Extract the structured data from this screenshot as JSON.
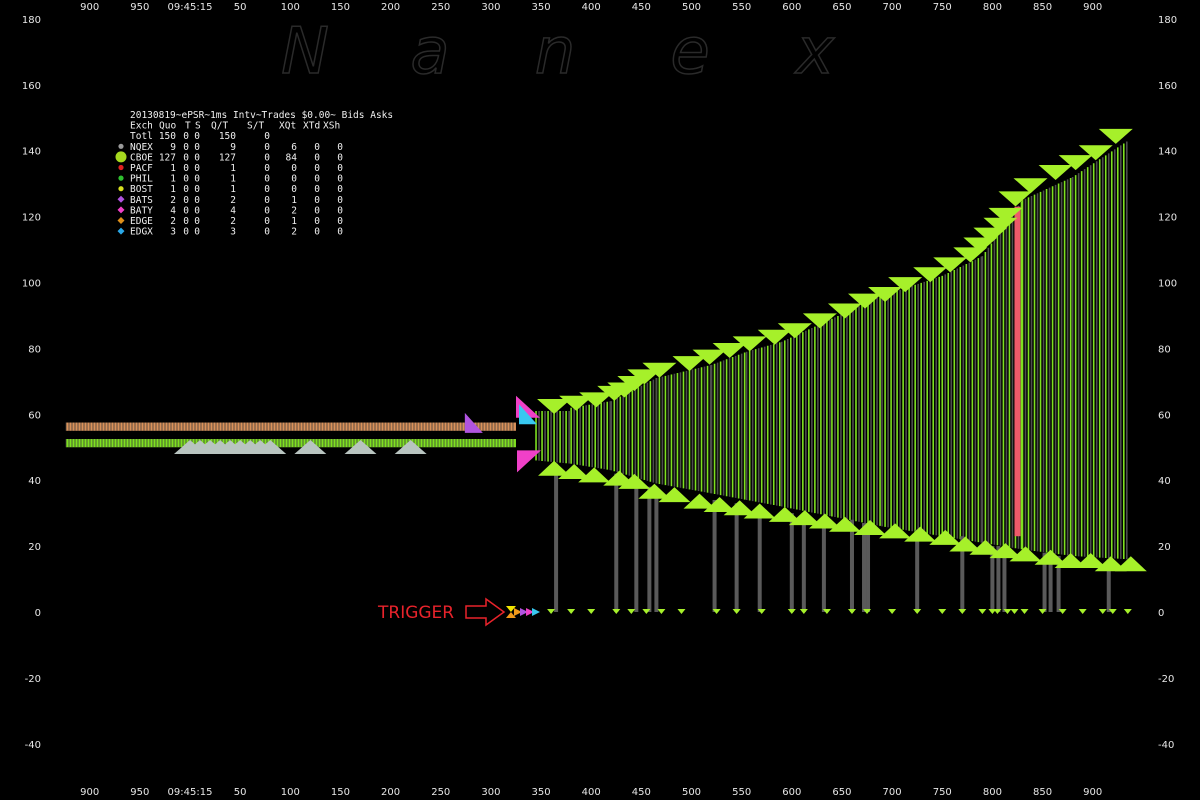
{
  "watermark": [
    "N",
    "a",
    "n",
    "e",
    "x"
  ],
  "info": {
    "header": "20130819~ePSR~1ms Intv~Trades $0.00~ Bids  Asks",
    "columns": [
      "Exch",
      "Quo",
      "T",
      "S",
      "Q/T",
      "S/T",
      "XQt",
      "XTd",
      "XSh"
    ],
    "rows": [
      {
        "exch": "Totl",
        "quo": "150",
        "t": "0",
        "s": "0",
        "qt": "150",
        "st": "0",
        "xqt": "",
        "xtd": "",
        "xsh": "",
        "color": ""
      },
      {
        "exch": "NQEX",
        "quo": "9",
        "t": "0",
        "s": "0",
        "qt": "9",
        "st": "0",
        "xqt": "6",
        "xtd": "0",
        "xsh": "0",
        "color": "#9a9a9a"
      },
      {
        "exch": "CBOE",
        "quo": "127",
        "t": "0",
        "s": "0",
        "qt": "127",
        "st": "0",
        "xqt": "84",
        "xtd": "0",
        "xsh": "0",
        "color": "#a6d81f"
      },
      {
        "exch": "PACF",
        "quo": "1",
        "t": "0",
        "s": "0",
        "qt": "1",
        "st": "0",
        "xqt": "0",
        "xtd": "0",
        "xsh": "0",
        "color": "#e02020"
      },
      {
        "exch": "PHIL",
        "quo": "1",
        "t": "0",
        "s": "0",
        "qt": "1",
        "st": "0",
        "xqt": "0",
        "xtd": "0",
        "xsh": "0",
        "color": "#2fbf2f"
      },
      {
        "exch": "BOST",
        "quo": "1",
        "t": "0",
        "s": "0",
        "qt": "1",
        "st": "0",
        "xqt": "0",
        "xtd": "0",
        "xsh": "0",
        "color": "#d8e020"
      },
      {
        "exch": "BATS",
        "quo": "2",
        "t": "0",
        "s": "0",
        "qt": "2",
        "st": "0",
        "xqt": "1",
        "xtd": "0",
        "xsh": "0",
        "color": "#b054e0"
      },
      {
        "exch": "BATY",
        "quo": "4",
        "t": "0",
        "s": "0",
        "qt": "4",
        "st": "0",
        "xqt": "2",
        "xtd": "0",
        "xsh": "0",
        "color": "#f040c8"
      },
      {
        "exch": "EDGE",
        "quo": "2",
        "t": "0",
        "s": "0",
        "qt": "2",
        "st": "0",
        "xqt": "1",
        "xtd": "0",
        "xsh": "0",
        "color": "#e0901a"
      },
      {
        "exch": "EDGX",
        "quo": "3",
        "t": "0",
        "s": "0",
        "qt": "3",
        "st": "0",
        "xqt": "2",
        "xtd": "0",
        "xsh": "0",
        "color": "#2aa8e8"
      }
    ]
  },
  "annotation": {
    "label": "TRIGGER",
    "color": "#e8232b",
    "x": 340,
    "y": 0
  },
  "colors": {
    "background": "#000000",
    "cboe": "#a6f02a",
    "spread_gray": "#4d4d4d",
    "spread_green": "#7ee020",
    "pink": "#ee5a6a",
    "orange_band": "#d9925a",
    "gray_triangle": "#b8c4c0",
    "purple": "#b054e0",
    "magenta": "#f040c8",
    "cyan": "#38c8f0",
    "axis_text": "#e6e6e6"
  },
  "chart_data": {
    "type": "bar",
    "x_tick_labels": [
      "900",
      "950",
      "09:45:15",
      "50",
      "100",
      "150",
      "200",
      "250",
      "300",
      "350",
      "400",
      "450",
      "500",
      "550",
      "600",
      "650",
      "700",
      "750",
      "800",
      "850",
      "900"
    ],
    "x_tick_values": [
      -100,
      -50,
      0,
      50,
      100,
      150,
      200,
      250,
      300,
      350,
      400,
      450,
      500,
      550,
      600,
      650,
      700,
      750,
      800,
      850,
      900
    ],
    "xlim": [
      -135,
      975
    ],
    "ylim": [
      -45,
      180
    ],
    "y_ticks": [
      180,
      160,
      140,
      120,
      100,
      80,
      60,
      40,
      20,
      0,
      -20,
      -40
    ],
    "pre_trigger_bands": [
      {
        "x0": -135,
        "x1": 325,
        "y0": 55,
        "y1": 57.5,
        "fill": "orange"
      },
      {
        "x0": -135,
        "x1": 325,
        "y0": 50,
        "y1": 52.5,
        "fill": "green"
      }
    ],
    "gray_bid_triangles": [
      0,
      10,
      20,
      30,
      40,
      50,
      60,
      70,
      80,
      120,
      170,
      220
    ],
    "gray_bid_level": 51,
    "early_quotes": [
      {
        "x": 280,
        "y": 58,
        "color": "purple"
      },
      {
        "x": 333,
        "y": 62,
        "color": "magenta"
      },
      {
        "x": 336,
        "y": 60,
        "color": "cyan"
      },
      {
        "x": 334,
        "y": 46,
        "color": "magenta"
      }
    ],
    "quote_runs": [
      {
        "x0": 345,
        "x1": 380,
        "ask0": 61,
        "ask1": 61,
        "bid0": 46,
        "bid1": 45
      },
      {
        "x0": 380,
        "x1": 420,
        "ask0": 62,
        "ask1": 64,
        "bid0": 45,
        "bid1": 43
      },
      {
        "x0": 420,
        "x1": 465,
        "ask0": 64,
        "ask1": 71,
        "bid0": 43,
        "bid1": 39
      },
      {
        "x0": 465,
        "x1": 520,
        "ask0": 71,
        "ask1": 75,
        "bid0": 39,
        "bid1": 36
      },
      {
        "x0": 520,
        "x1": 555,
        "ask0": 75,
        "ask1": 79,
        "bid0": 36,
        "bid1": 34
      },
      {
        "x0": 555,
        "x1": 590,
        "ask0": 79,
        "ask1": 82,
        "bid0": 34,
        "bid1": 32
      },
      {
        "x0": 590,
        "x1": 640,
        "ask0": 82,
        "ask1": 89,
        "bid0": 32,
        "bid1": 29
      },
      {
        "x0": 640,
        "x1": 690,
        "ask0": 89,
        "ask1": 96,
        "bid0": 29,
        "bid1": 26
      },
      {
        "x0": 690,
        "x1": 750,
        "ask0": 96,
        "ask1": 102,
        "bid0": 26,
        "bid1": 23
      },
      {
        "x0": 750,
        "x1": 790,
        "ask0": 102,
        "ask1": 108,
        "bid0": 23,
        "bid1": 21
      },
      {
        "x0": 790,
        "x1": 830,
        "ask0": 108,
        "ask1": 125,
        "bid0": 21,
        "bid1": 19
      },
      {
        "x0": 830,
        "x1": 880,
        "ask0": 125,
        "ask1": 132,
        "bid0": 19,
        "bid1": 17
      },
      {
        "x0": 880,
        "x1": 935,
        "ask0": 132,
        "ask1": 143,
        "bid0": 17,
        "bid1": 16
      }
    ],
    "ask_markers": [
      {
        "x": 363,
        "y": 61
      },
      {
        "x": 385,
        "y": 62
      },
      {
        "x": 405,
        "y": 63
      },
      {
        "x": 423,
        "y": 65
      },
      {
        "x": 433,
        "y": 66
      },
      {
        "x": 443,
        "y": 68
      },
      {
        "x": 453,
        "y": 70
      },
      {
        "x": 468,
        "y": 72
      },
      {
        "x": 498,
        "y": 74
      },
      {
        "x": 518,
        "y": 76
      },
      {
        "x": 538,
        "y": 78
      },
      {
        "x": 558,
        "y": 80
      },
      {
        "x": 583,
        "y": 82
      },
      {
        "x": 603,
        "y": 84
      },
      {
        "x": 628,
        "y": 87
      },
      {
        "x": 653,
        "y": 90
      },
      {
        "x": 673,
        "y": 93
      },
      {
        "x": 693,
        "y": 95
      },
      {
        "x": 713,
        "y": 98
      },
      {
        "x": 738,
        "y": 101
      },
      {
        "x": 758,
        "y": 104
      },
      {
        "x": 778,
        "y": 107
      },
      {
        "x": 788,
        "y": 110
      },
      {
        "x": 798,
        "y": 113
      },
      {
        "x": 808,
        "y": 116
      },
      {
        "x": 813,
        "y": 119
      },
      {
        "x": 823,
        "y": 124
      },
      {
        "x": 838,
        "y": 128
      },
      {
        "x": 863,
        "y": 132
      },
      {
        "x": 883,
        "y": 135
      },
      {
        "x": 903,
        "y": 138
      },
      {
        "x": 923,
        "y": 143
      }
    ],
    "bid_markers": [
      {
        "x": 363,
        "y": 45
      },
      {
        "x": 383,
        "y": 44
      },
      {
        "x": 403,
        "y": 43
      },
      {
        "x": 428,
        "y": 42
      },
      {
        "x": 443,
        "y": 41
      },
      {
        "x": 463,
        "y": 38
      },
      {
        "x": 483,
        "y": 37
      },
      {
        "x": 508,
        "y": 35
      },
      {
        "x": 528,
        "y": 34
      },
      {
        "x": 548,
        "y": 33
      },
      {
        "x": 568,
        "y": 32
      },
      {
        "x": 593,
        "y": 31
      },
      {
        "x": 613,
        "y": 30
      },
      {
        "x": 633,
        "y": 29
      },
      {
        "x": 653,
        "y": 28
      },
      {
        "x": 678,
        "y": 27
      },
      {
        "x": 703,
        "y": 26
      },
      {
        "x": 728,
        "y": 25
      },
      {
        "x": 753,
        "y": 24
      },
      {
        "x": 773,
        "y": 22
      },
      {
        "x": 793,
        "y": 21
      },
      {
        "x": 813,
        "y": 20
      },
      {
        "x": 833,
        "y": 19
      },
      {
        "x": 858,
        "y": 18
      },
      {
        "x": 878,
        "y": 17
      },
      {
        "x": 898,
        "y": 17
      },
      {
        "x": 918,
        "y": 16
      },
      {
        "x": 938,
        "y": 16
      }
    ],
    "drop_bars": [
      {
        "x": 365,
        "top": 45
      },
      {
        "x": 425,
        "top": 42
      },
      {
        "x": 445,
        "top": 40
      },
      {
        "x": 458,
        "top": 38
      },
      {
        "x": 465,
        "top": 37
      },
      {
        "x": 523,
        "top": 34
      },
      {
        "x": 545,
        "top": 33
      },
      {
        "x": 568,
        "top": 32
      },
      {
        "x": 600,
        "top": 30
      },
      {
        "x": 612,
        "top": 30
      },
      {
        "x": 632,
        "top": 29
      },
      {
        "x": 660,
        "top": 28
      },
      {
        "x": 672,
        "top": 27
      },
      {
        "x": 676,
        "top": 27
      },
      {
        "x": 725,
        "top": 25
      },
      {
        "x": 770,
        "top": 23
      },
      {
        "x": 800,
        "top": 20
      },
      {
        "x": 806,
        "top": 20
      },
      {
        "x": 812,
        "top": 19
      },
      {
        "x": 852,
        "top": 18
      },
      {
        "x": 858,
        "top": 18
      },
      {
        "x": 866,
        "top": 17
      },
      {
        "x": 916,
        "top": 16
      }
    ],
    "pink_bar": {
      "x0": 822,
      "x1": 828,
      "y0": 23,
      "y1": 123
    },
    "zero_markers": [
      360,
      380,
      400,
      425,
      440,
      455,
      470,
      490,
      525,
      545,
      570,
      600,
      612,
      635,
      660,
      675,
      700,
      725,
      750,
      770,
      790,
      800,
      805,
      815,
      822,
      832,
      850,
      870,
      890,
      910,
      920,
      935
    ],
    "trigger_markers": [
      {
        "x": 320,
        "color": "yellow"
      },
      {
        "x": 327,
        "color": "orange"
      },
      {
        "x": 333,
        "color": "purple"
      },
      {
        "x": 339,
        "color": "magenta"
      },
      {
        "x": 345,
        "color": "cyan"
      }
    ]
  }
}
